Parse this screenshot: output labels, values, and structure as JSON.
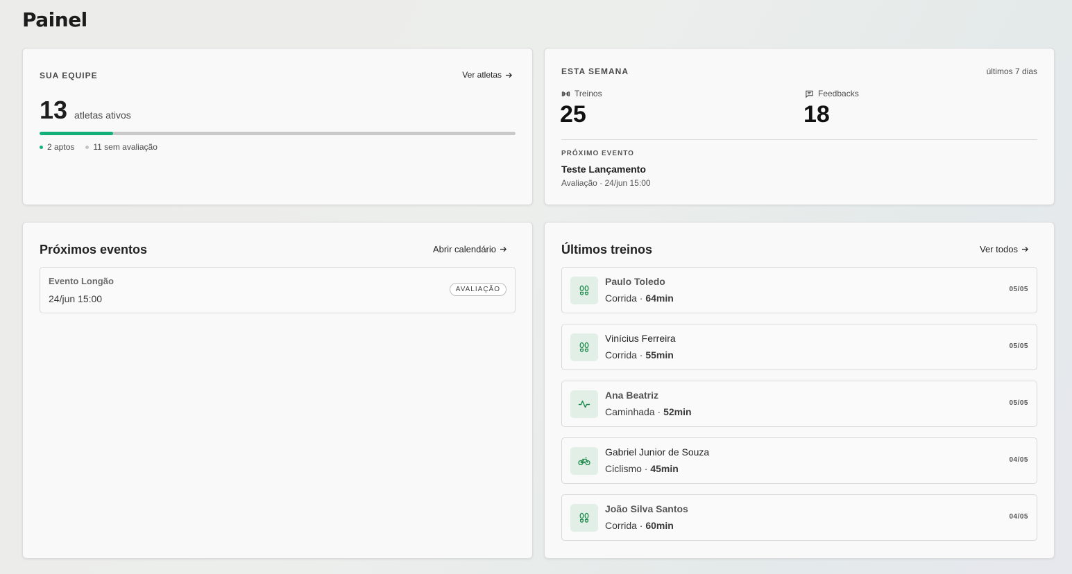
{
  "page": {
    "title": "Painel"
  },
  "team": {
    "label": "SUA EQUIPE",
    "link_label": "Ver atletas",
    "count": "13",
    "count_caption": "atletas ativos",
    "progress_fraction": 0.154,
    "legend": [
      {
        "text": "2 aptos",
        "color": "#14b07a"
      },
      {
        "text": "11 sem avaliação",
        "color": "#c4c4c4"
      }
    ]
  },
  "week": {
    "label": "ESTA SEMANA",
    "range": "últimos 7 dias",
    "trainings_label": "Treinos",
    "trainings_value": "25",
    "feedbacks_label": "Feedbacks",
    "feedbacks_value": "18",
    "next_event_label": "PRÓXIMO EVENTO",
    "next_event_name": "Teste Lançamento",
    "next_event_meta": "Avaliação · 24/jun 15:00"
  },
  "events": {
    "title": "Próximos eventos",
    "link_label": "Abrir calendário",
    "items": [
      {
        "name": "Evento Longão",
        "date": "24/jun 15:00",
        "badge": "AVALIAÇÃO"
      }
    ]
  },
  "trainings": {
    "title": "Últimos treinos",
    "link_label": "Ver todos",
    "items": [
      {
        "athlete": "Paulo Toledo",
        "activity": "Corrida",
        "duration": "64min",
        "date": "05/05",
        "icon": "footprints-icon"
      },
      {
        "athlete": "Vinícius Ferreira",
        "activity": "Corrida",
        "duration": "55min",
        "date": "05/05",
        "icon": "footprints-icon"
      },
      {
        "athlete": "Ana Beatriz",
        "activity": "Caminhada",
        "duration": "52min",
        "date": "05/05",
        "icon": "activity-pulse-icon"
      },
      {
        "athlete": "Gabriel Junior de Souza",
        "activity": "Ciclismo",
        "duration": "45min",
        "date": "04/05",
        "icon": "bicycle-icon"
      },
      {
        "athlete": "João Silva Santos",
        "activity": "Corrida",
        "duration": "60min",
        "date": "04/05",
        "icon": "footprints-icon"
      }
    ]
  },
  "colors": {
    "accent": "#14b07a",
    "icon_green": "#1e8a4c",
    "icon_bg": "#e2efe7"
  }
}
